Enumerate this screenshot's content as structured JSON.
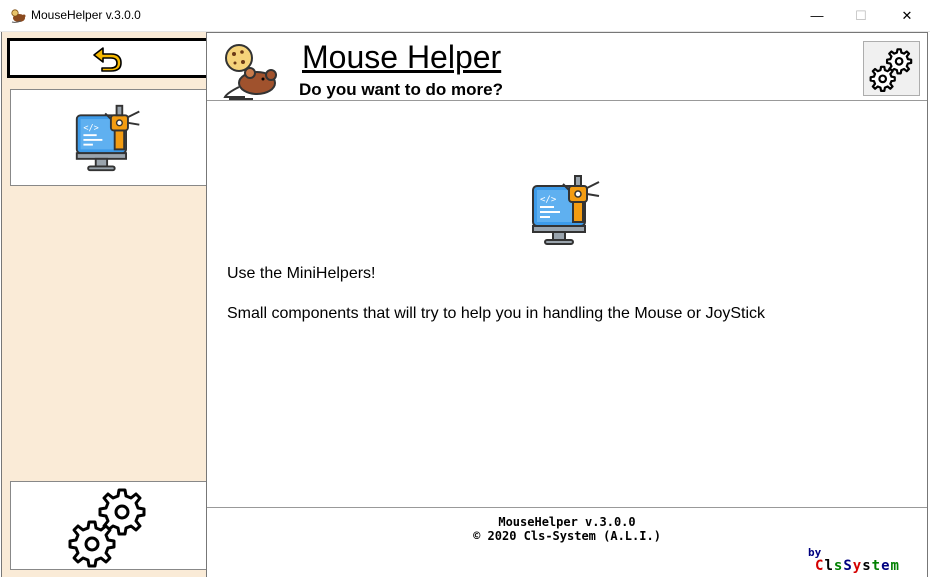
{
  "window": {
    "title": "MouseHelper v.3.0.0",
    "controls": {
      "minimize": "—",
      "maximize": "☐",
      "close": "✕"
    }
  },
  "header": {
    "title": "Mouse Helper",
    "subtitle": "Do you want to do more?"
  },
  "content": {
    "line1": "Use the MiniHelpers!",
    "line2": "Small components that will try to help you in handling the Mouse or JoyStick"
  },
  "footer": {
    "version": "MouseHelper v.3.0.0",
    "copyright": "©  2020 Cls-System (A.L.I.)",
    "by": "by",
    "brand": [
      "C",
      "l",
      "s",
      "S",
      "y",
      "s",
      "t",
      "e",
      "m"
    ],
    "brand_colors": [
      "#d40000",
      "#000000",
      "#008000",
      "#000080",
      "#d40000",
      "#000000",
      "#008000",
      "#000080",
      "#008000"
    ]
  },
  "icons": {
    "back": "undo-arrow-icon",
    "minihelpers": "computer-robot-arm-icon",
    "settings": "gears-icon",
    "logo": "mouse-cookie-icon"
  },
  "colors": {
    "sidebar_bg": "#faebd7",
    "accent_yellow": "#f5b800",
    "monitor_blue": "#3d9be9",
    "robot_orange": "#f39c12"
  }
}
